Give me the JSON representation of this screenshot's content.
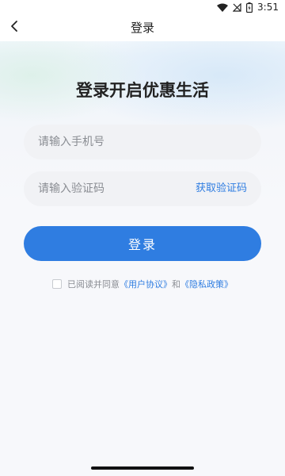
{
  "status_bar": {
    "time": "3:51",
    "icons": [
      "wifi-icon",
      "signal-off-icon",
      "battery-charging-icon"
    ]
  },
  "nav": {
    "back_icon": "chevron-left-icon",
    "title": "登录"
  },
  "headline": "登录开启优惠生活",
  "phone_field": {
    "placeholder": "请输入手机号",
    "value": ""
  },
  "code_field": {
    "placeholder": "请输入验证码",
    "value": "",
    "get_code_label": "获取验证码"
  },
  "login_button": {
    "label": "登录"
  },
  "agreement": {
    "checked": false,
    "prefix": "已阅读并同意",
    "user_agreement": "《用户协议》",
    "conjunction": "和",
    "privacy_policy": "《隐私政策》"
  },
  "colors": {
    "accent": "#2f7de1",
    "field_bg": "#f1f2f5",
    "placeholder": "#8a8d93"
  }
}
